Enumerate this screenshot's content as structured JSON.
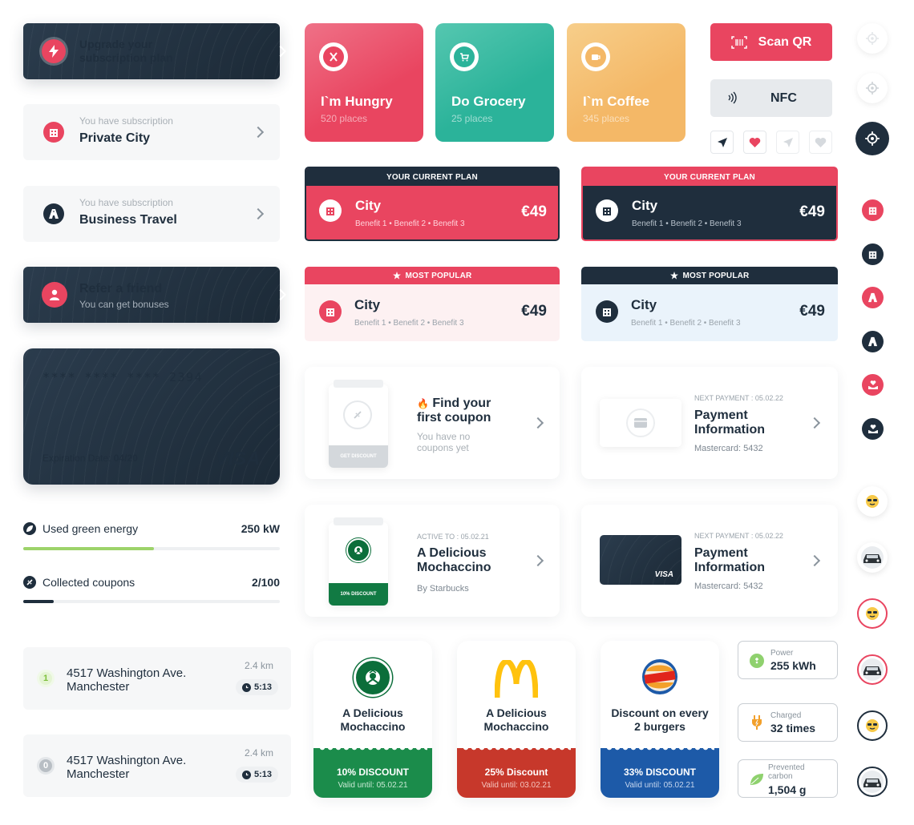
{
  "colors": {
    "red": "#e94560",
    "navy": "#1f2e3d",
    "teal": "#2bb39a",
    "orange": "#f4bd6b",
    "green": "#1e8a4c",
    "mcred": "#c0392b",
    "bkblue": "#1d5aa8",
    "energy": "#9dd36a"
  },
  "upgrade": {
    "label": "Upgrade your subscription plan",
    "icon": "lightning-icon"
  },
  "subs": [
    {
      "caption": "You have subscription",
      "name": "Private City",
      "icon": "building-icon"
    },
    {
      "caption": "You have subscription",
      "name": "Business Travel",
      "icon": "highway-icon"
    }
  ],
  "refer": {
    "title": "Refer a friend",
    "subtitle": "You can get bonuses",
    "icon": "person-icon"
  },
  "credit_card": {
    "number": "**** **** **** 2394",
    "exp_label": "Expiration Date:",
    "exp_value": "04/20",
    "brand": "VISA"
  },
  "progress": [
    {
      "label": "Used green energy",
      "value": "250 kW",
      "fraction": 0.51,
      "color": "#9dd36a",
      "icon": "leaf-icon"
    },
    {
      "label": "Collected coupons",
      "value": "2/100",
      "fraction": 0.12,
      "color": "#1f2e3d",
      "icon": "coupon-icon"
    }
  ],
  "addresses": [
    {
      "index": "1",
      "line1": "4517 Washington Ave.",
      "line2": "Manchester",
      "distance": "2.4 km",
      "time": "5:13",
      "active": true
    },
    {
      "index": "0",
      "line1": "4517 Washington Ave.",
      "line2": "Manchester",
      "distance": "2.4 km",
      "time": "5:13",
      "active": false
    }
  ],
  "categories": [
    {
      "title": "I`m Hungry",
      "subtitle": "520 places",
      "icon": "fork-knife-icon"
    },
    {
      "title": "Do Grocery",
      "subtitle": "25 places",
      "icon": "cart-icon"
    },
    {
      "title": "I`m Coffee",
      "subtitle": "345 places",
      "icon": "coffee-icon"
    }
  ],
  "actions": {
    "scan": "Scan QR",
    "nfc": "NFC"
  },
  "plans": {
    "current_banner": "YOUR CURRENT PLAN",
    "popular_banner": "MOST POPULAR",
    "name": "City",
    "benefits": "Benefit 1 • Benefit 2 • Benefit 3",
    "price": "€49"
  },
  "coupon_empty": {
    "emoji": "🔥",
    "title": "Find your first coupon",
    "subtitle": "You have no coupons yet",
    "stub": "GET DISCOUNT"
  },
  "coupon_active": {
    "caption": "ACTIVE TO : 05.02.21",
    "title": "A Delicious Mochaccino",
    "by": "By Starbucks",
    "stub": "10% DISCOUNT"
  },
  "payment1": {
    "caption": "NEXT PAYMENT : 05.02.22",
    "title": "Payment Information",
    "sub": "Mastercard: 5432"
  },
  "payment2": {
    "caption": "NEXT PAYMENT : 05.02.22",
    "title": "Payment Information",
    "sub": "Mastercard: 5432",
    "brand": "VISA"
  },
  "brand_coupons": [
    {
      "title": "A Delicious Mochaccino",
      "discount": "10% DISCOUNT",
      "valid": "Valid until: 05.02.21",
      "logo": "starbucks-logo"
    },
    {
      "title": "A Delicious Mochaccino",
      "discount": "25% Discount",
      "valid": "Valid until: 03.02.21",
      "logo": "mcdonalds-logo"
    },
    {
      "title": "Discount on every 2 burgers",
      "discount": "33% DISCOUNT",
      "valid": "Valid until: 05.02.21",
      "logo": "burger-king-logo"
    }
  ],
  "stats": [
    {
      "label": "Power",
      "value": "255 kWh",
      "icon": "plug-icon"
    },
    {
      "label": "Charged",
      "value": "32 times",
      "icon": "charge-icon"
    },
    {
      "label": "Prevented carbon",
      "value": "1,504 g",
      "icon": "leaf-icon"
    }
  ]
}
